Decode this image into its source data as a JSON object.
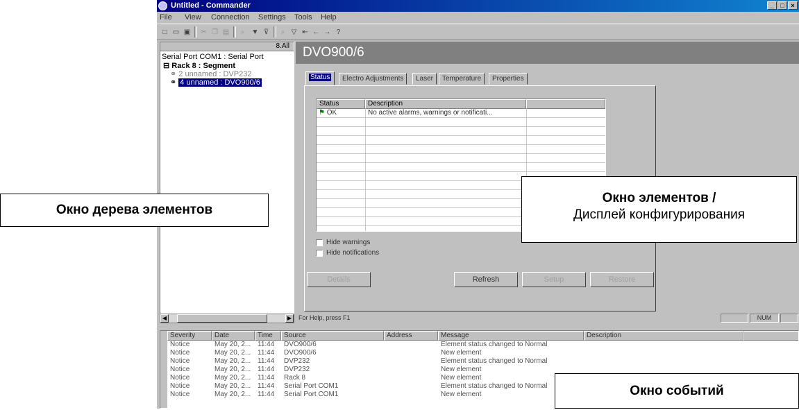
{
  "window": {
    "title": "Untitled - Commander"
  },
  "menu": [
    "File",
    "View",
    "Connection",
    "Settings",
    "Tools",
    "Help"
  ],
  "tree": {
    "header": "8.All",
    "nodes": [
      {
        "label": "Serial Port COM1 : Serial Port",
        "indent": 0,
        "selected": false,
        "gray": false
      },
      {
        "label": "Rack 8 : Segment",
        "indent": 1,
        "selected": false,
        "gray": false
      },
      {
        "label": "2 unnamed : DVP232",
        "indent": 2,
        "selected": false,
        "gray": true
      },
      {
        "label": "4 unnamed : DVO900/6",
        "indent": 2,
        "selected": true,
        "gray": false
      }
    ]
  },
  "element": {
    "title": "DVO900/6",
    "tabs": [
      "Status",
      "Electro Adjustments",
      "Laser",
      "Temperature",
      "Properties"
    ],
    "active_tab": 0,
    "list": {
      "columns": [
        "Status",
        "Description"
      ],
      "rows": [
        {
          "status": "OK",
          "description": "No active alarms, warnings or notificati..."
        }
      ]
    },
    "checkboxes": [
      "Hide warnings",
      "Hide notifications"
    ],
    "buttons": [
      "Details",
      "Refresh",
      "Setup",
      "Restore"
    ]
  },
  "statusbar": {
    "message": "For Help, press F1",
    "num": "NUM"
  },
  "events": {
    "columns": [
      "Severity",
      "Date",
      "Time",
      "Source",
      "Address",
      "Message",
      "Description"
    ],
    "rows": [
      {
        "severity": "Notice",
        "date": "May 20, 2...",
        "time": "11:44",
        "source": "DVO900/6",
        "address": "",
        "message": "Element status changed to Normal"
      },
      {
        "severity": "Notice",
        "date": "May 20, 2...",
        "time": "11:44",
        "source": "DVO900/6",
        "address": "",
        "message": "New element"
      },
      {
        "severity": "Notice",
        "date": "May 20, 2...",
        "time": "11:44",
        "source": "DVP232",
        "address": "",
        "message": "Element status changed to Normal"
      },
      {
        "severity": "Notice",
        "date": "May 20, 2...",
        "time": "11:44",
        "source": "DVP232",
        "address": "",
        "message": "New element"
      },
      {
        "severity": "Notice",
        "date": "May 20, 2...",
        "time": "11:44",
        "source": "Rack 8",
        "address": "",
        "message": "New element"
      },
      {
        "severity": "Notice",
        "date": "May 20, 2...",
        "time": "11:44",
        "source": "Serial Port COM1",
        "address": "",
        "message": "Element status changed to Normal"
      },
      {
        "severity": "Notice",
        "date": "May 20, 2...",
        "time": "11:44",
        "source": "Serial Port COM1",
        "address": "",
        "message": "New element"
      }
    ]
  },
  "callouts": {
    "tree": "Окно дерева элементов",
    "elements_line1": "Окно элементов /",
    "elements_line2": "Дисплей конфигурирования",
    "events": "Окно событий"
  },
  "colors": {
    "title_bar": "#000080",
    "selection": "#000080",
    "element_header": "#808080",
    "window_face": "#c0c0c0"
  }
}
